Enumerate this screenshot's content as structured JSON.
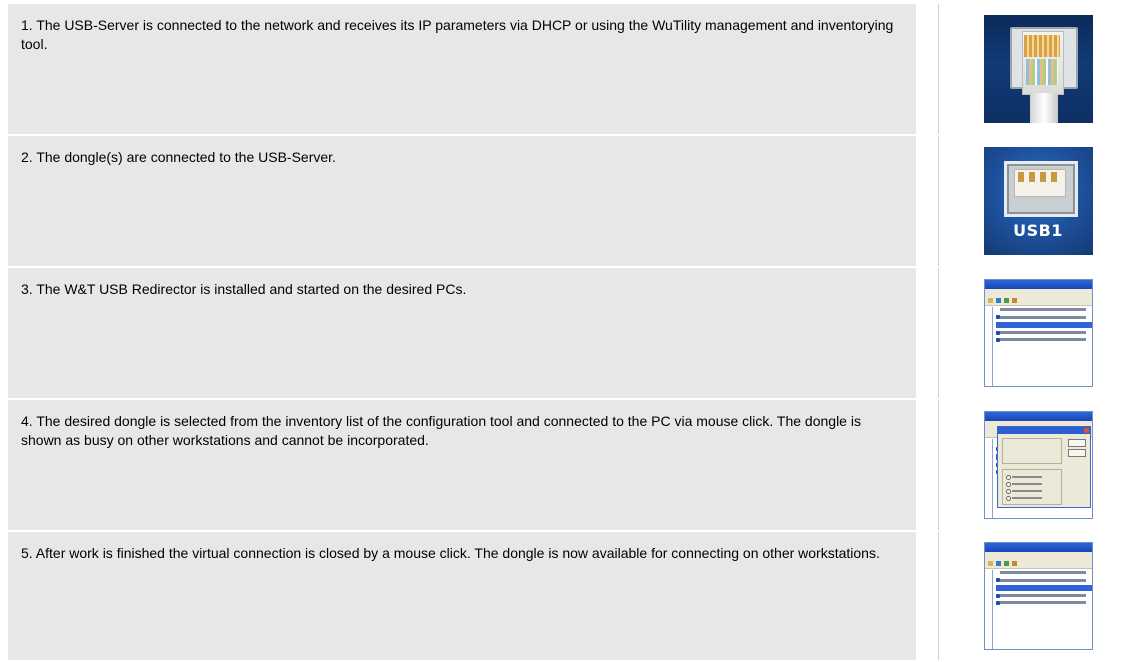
{
  "steps": [
    {
      "text": "1. The USB-Server is connected to the network and receives its IP parameters via DHCP or using the WuTility management and inventorying tool.",
      "image": "ethernet-plug-photo"
    },
    {
      "text": "2. The dongle(s) are connected to the USB-Server.",
      "image": "usb-port-photo",
      "image_label": "USB1"
    },
    {
      "text": "3. The W&T USB Redirector is installed and started on the desired PCs.",
      "image": "usb-redirector-screenshot"
    },
    {
      "text": "4. The desired dongle is selected from the inventory list of the configuration tool and connected to the PC via mouse click. The dongle is shown as busy on other workstations and cannot be incorporated.",
      "image": "connect-dialog-screenshot"
    },
    {
      "text": "5. After work is finished the virtual connection is closed by a mouse click. The dongle is now available for connecting on other workstations.",
      "image": "usb-redirector-screenshot"
    }
  ],
  "colors": {
    "row_background": "#e7e7e7",
    "titlebar_blue": "#2f66d8",
    "selection_blue": "#2d63d6"
  }
}
